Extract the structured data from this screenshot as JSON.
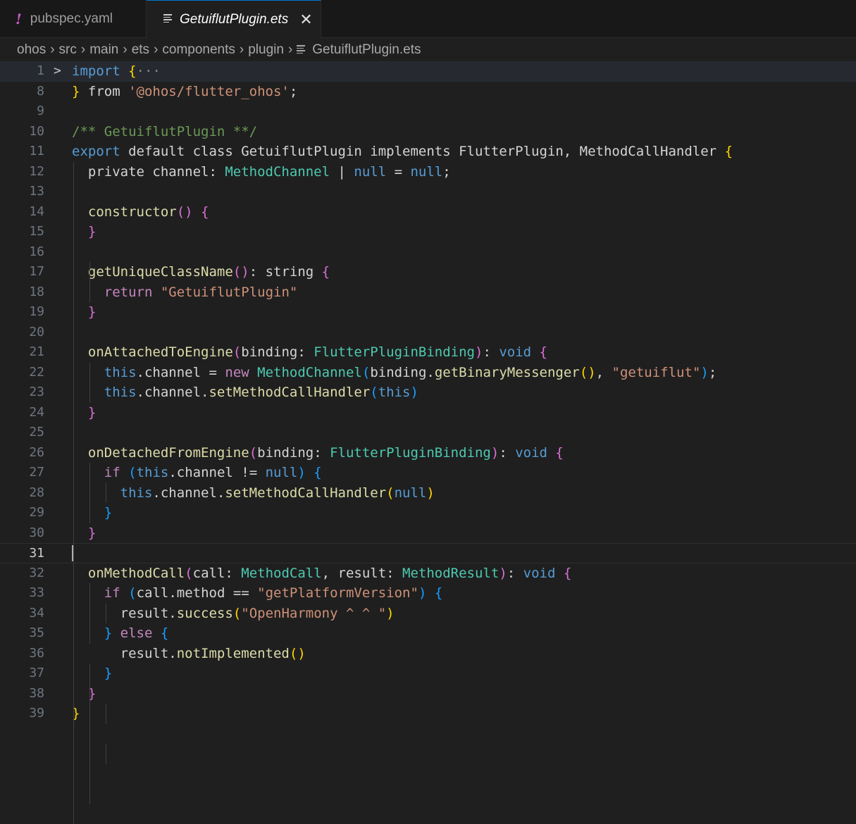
{
  "tabs": [
    {
      "label": "pubspec.yaml",
      "icon": "exclamation-icon"
    },
    {
      "label": "GetuiflutPlugin.ets",
      "icon": "lines-icon",
      "active": true
    }
  ],
  "close_glyph": "✕",
  "breadcrumb": [
    "ohos",
    "src",
    "main",
    "ets",
    "components",
    "plugin",
    "GetuiflutPlugin.ets"
  ],
  "breadcrumb_sep": "›",
  "active_line": "31",
  "lines": [
    {
      "n": "1",
      "t": [
        [
          "kw",
          "import"
        ],
        [
          "pl",
          " "
        ],
        [
          "b1",
          "{"
        ],
        [
          "dots",
          "···"
        ]
      ]
    },
    {
      "n": "8",
      "t": [
        [
          "b1",
          "}"
        ],
        [
          "pl",
          " from "
        ],
        [
          "str",
          "'@ohos/flutter_ohos'"
        ],
        [
          "pl",
          ";"
        ]
      ]
    },
    {
      "n": "9",
      "t": []
    },
    {
      "n": "10",
      "t": [
        [
          "cm",
          "/** GetuiflutPlugin **/"
        ]
      ]
    },
    {
      "n": "11",
      "t": [
        [
          "kw",
          "export"
        ],
        [
          "pl",
          " default class GetuiflutPlugin implements FlutterPlugin, MethodCallHandler "
        ],
        [
          "b1",
          "{"
        ]
      ]
    },
    {
      "n": "12",
      "t": [
        [
          "pl",
          "  private channel: "
        ],
        [
          "ty",
          "MethodChannel"
        ],
        [
          "pl",
          " | "
        ],
        [
          "kw",
          "null"
        ],
        [
          "pl",
          " = "
        ],
        [
          "kw",
          "null"
        ],
        [
          "pl",
          ";"
        ]
      ]
    },
    {
      "n": "13",
      "t": []
    },
    {
      "n": "14",
      "t": [
        [
          "pl",
          "  "
        ],
        [
          "fn",
          "constructor"
        ],
        [
          "b2",
          "()"
        ],
        [
          "pl",
          " "
        ],
        [
          "b2",
          "{"
        ]
      ]
    },
    {
      "n": "15",
      "t": [
        [
          "pl",
          "  "
        ],
        [
          "b2",
          "}"
        ]
      ]
    },
    {
      "n": "16",
      "t": []
    },
    {
      "n": "17",
      "t": [
        [
          "pl",
          "  "
        ],
        [
          "fn",
          "getUniqueClassName"
        ],
        [
          "b2",
          "()"
        ],
        [
          "pl",
          ": string "
        ],
        [
          "b2",
          "{"
        ]
      ]
    },
    {
      "n": "18",
      "t": [
        [
          "pl",
          "    "
        ],
        [
          "ctl",
          "return"
        ],
        [
          "pl",
          " "
        ],
        [
          "str",
          "\"GetuiflutPlugin\""
        ]
      ]
    },
    {
      "n": "19",
      "t": [
        [
          "pl",
          "  "
        ],
        [
          "b2",
          "}"
        ]
      ]
    },
    {
      "n": "20",
      "t": []
    },
    {
      "n": "21",
      "t": [
        [
          "pl",
          "  "
        ],
        [
          "fn",
          "onAttachedToEngine"
        ],
        [
          "b2",
          "("
        ],
        [
          "pl",
          "binding: "
        ],
        [
          "ty",
          "FlutterPluginBinding"
        ],
        [
          "b2",
          ")"
        ],
        [
          "pl",
          ": "
        ],
        [
          "kw",
          "void"
        ],
        [
          "pl",
          " "
        ],
        [
          "b2",
          "{"
        ]
      ]
    },
    {
      "n": "22",
      "t": [
        [
          "pl",
          "    "
        ],
        [
          "kw",
          "this"
        ],
        [
          "pl",
          ".channel = "
        ],
        [
          "ctl",
          "new"
        ],
        [
          "pl",
          " "
        ],
        [
          "ty",
          "MethodChannel"
        ],
        [
          "b3",
          "("
        ],
        [
          "pl",
          "binding."
        ],
        [
          "fn",
          "getBinaryMessenger"
        ],
        [
          "b1",
          "()"
        ],
        [
          "pl",
          ", "
        ],
        [
          "str",
          "\"getuiflut\""
        ],
        [
          "b3",
          ")"
        ],
        [
          "pl",
          ";"
        ]
      ]
    },
    {
      "n": "23",
      "t": [
        [
          "pl",
          "    "
        ],
        [
          "kw",
          "this"
        ],
        [
          "pl",
          ".channel."
        ],
        [
          "fn",
          "setMethodCallHandler"
        ],
        [
          "b3",
          "("
        ],
        [
          "kw",
          "this"
        ],
        [
          "b3",
          ")"
        ]
      ]
    },
    {
      "n": "24",
      "t": [
        [
          "pl",
          "  "
        ],
        [
          "b2",
          "}"
        ]
      ]
    },
    {
      "n": "25",
      "t": []
    },
    {
      "n": "26",
      "t": [
        [
          "pl",
          "  "
        ],
        [
          "fn",
          "onDetachedFromEngine"
        ],
        [
          "b2",
          "("
        ],
        [
          "pl",
          "binding: "
        ],
        [
          "ty",
          "FlutterPluginBinding"
        ],
        [
          "b2",
          ")"
        ],
        [
          "pl",
          ": "
        ],
        [
          "kw",
          "void"
        ],
        [
          "pl",
          " "
        ],
        [
          "b2",
          "{"
        ]
      ]
    },
    {
      "n": "27",
      "t": [
        [
          "pl",
          "    "
        ],
        [
          "ctl",
          "if"
        ],
        [
          "pl",
          " "
        ],
        [
          "b3",
          "("
        ],
        [
          "kw",
          "this"
        ],
        [
          "pl",
          ".channel != "
        ],
        [
          "kw",
          "null"
        ],
        [
          "b3",
          ")"
        ],
        [
          "pl",
          " "
        ],
        [
          "b3",
          "{"
        ]
      ]
    },
    {
      "n": "28",
      "t": [
        [
          "pl",
          "      "
        ],
        [
          "kw",
          "this"
        ],
        [
          "pl",
          ".channel."
        ],
        [
          "fn",
          "setMethodCallHandler"
        ],
        [
          "b1",
          "("
        ],
        [
          "kw",
          "null"
        ],
        [
          "b1",
          ")"
        ]
      ]
    },
    {
      "n": "29",
      "t": [
        [
          "pl",
          "    "
        ],
        [
          "b3",
          "}"
        ]
      ]
    },
    {
      "n": "30",
      "t": [
        [
          "pl",
          "  "
        ],
        [
          "b2",
          "}"
        ]
      ]
    },
    {
      "n": "31",
      "t": []
    },
    {
      "n": "32",
      "t": [
        [
          "pl",
          "  "
        ],
        [
          "fn",
          "onMethodCall"
        ],
        [
          "b2",
          "("
        ],
        [
          "pl",
          "call: "
        ],
        [
          "ty",
          "MethodCall"
        ],
        [
          "pl",
          ", result: "
        ],
        [
          "ty",
          "MethodResult"
        ],
        [
          "b2",
          ")"
        ],
        [
          "pl",
          ": "
        ],
        [
          "kw",
          "void"
        ],
        [
          "pl",
          " "
        ],
        [
          "b2",
          "{"
        ]
      ]
    },
    {
      "n": "33",
      "t": [
        [
          "pl",
          "    "
        ],
        [
          "ctl",
          "if"
        ],
        [
          "pl",
          " "
        ],
        [
          "b3",
          "("
        ],
        [
          "pl",
          "call.method == "
        ],
        [
          "str",
          "\"getPlatformVersion\""
        ],
        [
          "b3",
          ")"
        ],
        [
          "pl",
          " "
        ],
        [
          "b3",
          "{"
        ]
      ]
    },
    {
      "n": "34",
      "t": [
        [
          "pl",
          "      result."
        ],
        [
          "fn",
          "success"
        ],
        [
          "b1",
          "("
        ],
        [
          "str",
          "\"OpenHarmony ^ ^ \""
        ],
        [
          "b1",
          ")"
        ]
      ]
    },
    {
      "n": "35",
      "t": [
        [
          "pl",
          "    "
        ],
        [
          "b3",
          "}"
        ],
        [
          "pl",
          " "
        ],
        [
          "ctl",
          "else"
        ],
        [
          "pl",
          " "
        ],
        [
          "b3",
          "{"
        ]
      ]
    },
    {
      "n": "36",
      "t": [
        [
          "pl",
          "      result."
        ],
        [
          "fn",
          "notImplemented"
        ],
        [
          "b1",
          "()"
        ]
      ]
    },
    {
      "n": "37",
      "t": [
        [
          "pl",
          "    "
        ],
        [
          "b3",
          "}"
        ]
      ]
    },
    {
      "n": "38",
      "t": [
        [
          "pl",
          "  "
        ],
        [
          "b2",
          "}"
        ]
      ]
    },
    {
      "n": "39",
      "t": [
        [
          "b1",
          "}"
        ]
      ]
    }
  ]
}
